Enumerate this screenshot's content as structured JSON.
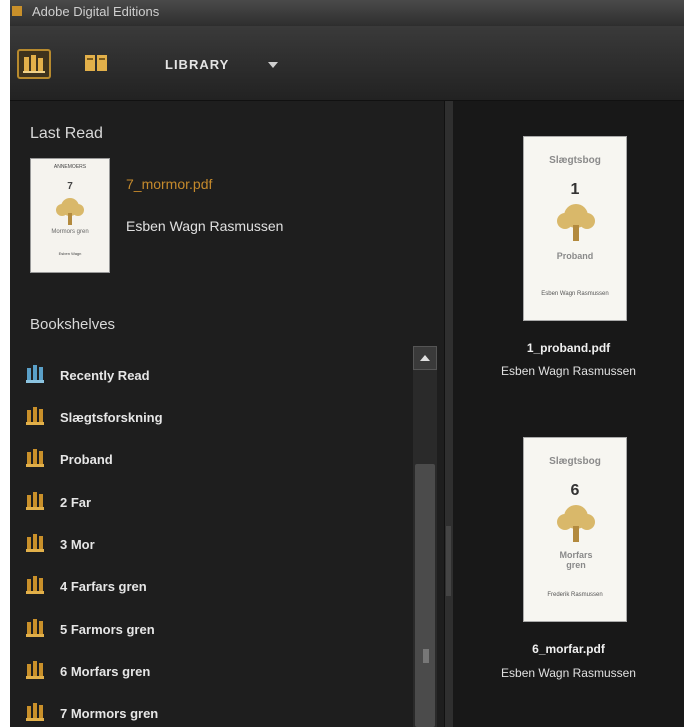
{
  "window": {
    "title": "Adobe Digital Editions"
  },
  "toolbar": {
    "library_label": "LIBRARY"
  },
  "colors": {
    "accent": "#c58a2c",
    "recent_shelf_icon": "#5aa0c8",
    "shelf_icon": "#c9902a"
  },
  "last_read": {
    "heading": "Last Read",
    "file_name": "7_mormor.pdf",
    "author": "Esben Wagn  Rasmussen",
    "cover": {
      "series": "ANNEMOERS",
      "number": "7",
      "name": "Mormors gren",
      "author": "Esben Wagn"
    }
  },
  "bookshelves": {
    "heading": "Bookshelves",
    "items": [
      {
        "label": "Recently Read",
        "icon": "recently-read-shelf-icon"
      },
      {
        "label": "Slægtsforskning",
        "icon": "shelf-icon"
      },
      {
        "label": "Proband",
        "icon": "shelf-icon"
      },
      {
        "label": "2 Far",
        "icon": "shelf-icon"
      },
      {
        "label": "3 Mor",
        "icon": "shelf-icon"
      },
      {
        "label": "4 Farfars gren",
        "icon": "shelf-icon"
      },
      {
        "label": "5 Farmors gren",
        "icon": "shelf-icon"
      },
      {
        "label": "6 Morfars gren",
        "icon": "shelf-icon"
      },
      {
        "label": "7 Mormors gren",
        "icon": "shelf-icon"
      }
    ]
  },
  "books": [
    {
      "file_name": "1_proband.pdf",
      "author": "Esben Wagn  Rasmussen",
      "cover": {
        "series": "Slægtsbog",
        "number": "1",
        "name": "Proband",
        "author": "Esben Wagn Rasmussen"
      }
    },
    {
      "file_name": "6_morfar.pdf",
      "author": "Esben Wagn  Rasmussen",
      "cover": {
        "series": "Slægtsbog",
        "number": "6",
        "name": "Morfars gren",
        "author": "Frederik Rasmussen"
      }
    }
  ]
}
